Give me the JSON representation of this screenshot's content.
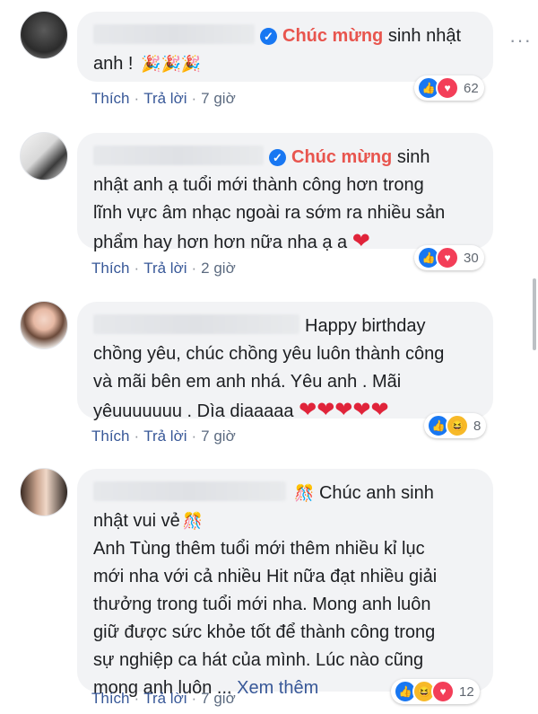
{
  "comments": [
    {
      "verified": true,
      "tag": "Chúc mừng",
      "text_inline": " sinh nhật",
      "text_lines": [
        "anh !"
      ],
      "emoji": "🎉🎉🎉",
      "actions": {
        "like": "Thích",
        "reply": "Trả lời",
        "time": "7 giờ"
      },
      "reactions": {
        "icons": [
          "like-icon",
          "love-icon"
        ],
        "count": "62"
      }
    },
    {
      "verified": true,
      "tag": "Chúc mừng",
      "text_inline": " sinh",
      "text_lines": [
        "nhật anh ạ tuổi mới thành công hơn trong",
        "lĩnh vực âm nhạc ngoài ra sớm ra nhiều sản",
        "phẩm hay hơn hơn nữa nha ạ a"
      ],
      "emoji": "❤",
      "actions": {
        "like": "Thích",
        "reply": "Trả lời",
        "time": "2 giờ"
      },
      "reactions": {
        "icons": [
          "like-icon",
          "love-icon"
        ],
        "count": "30"
      }
    },
    {
      "verified": false,
      "text_inline": "Happy birthday",
      "text_lines": [
        "chồng yêu, chúc chồng yêu luôn thành công",
        "và mãi bên em anh nhá. Yêu anh . Mãi",
        "yêuuuuuuu . Dìa diaaaaa"
      ],
      "emoji": "❤❤❤❤❤",
      "actions": {
        "like": "Thích",
        "reply": "Trả lời",
        "time": "7 giờ"
      },
      "reactions": {
        "icons": [
          "like-icon",
          "haha-icon"
        ],
        "count": "8"
      }
    },
    {
      "verified": false,
      "text_inline": "Chúc anh sinh",
      "text_lines": [
        "nhật vui vẻ",
        "Anh Tùng thêm tuổi mới thêm nhiều kỉ lục",
        "mới nha với cả nhiều Hit nữa đạt nhiều giải",
        "thưởng trong tuổi mới nha. Mong anh luôn",
        "giữ được sức khỏe tốt để thành công trong",
        "sự nghiệp ca hát của mình. Lúc nào cũng",
        "mong anh luôn ..."
      ],
      "see_more": "Xem thêm",
      "emoji": "🎊",
      "actions": {
        "like": "Thích",
        "reply": "Trả lời",
        "time": "7 giờ"
      },
      "reactions": {
        "icons": [
          "like-icon",
          "haha-icon",
          "love-icon"
        ],
        "count": "12"
      }
    }
  ],
  "colors": {
    "link": "#385898",
    "tag": "#e8554e",
    "bubble": "#f2f3f5",
    "like": "#1877f2",
    "love": "#f33e58",
    "haha": "#f7b928"
  }
}
